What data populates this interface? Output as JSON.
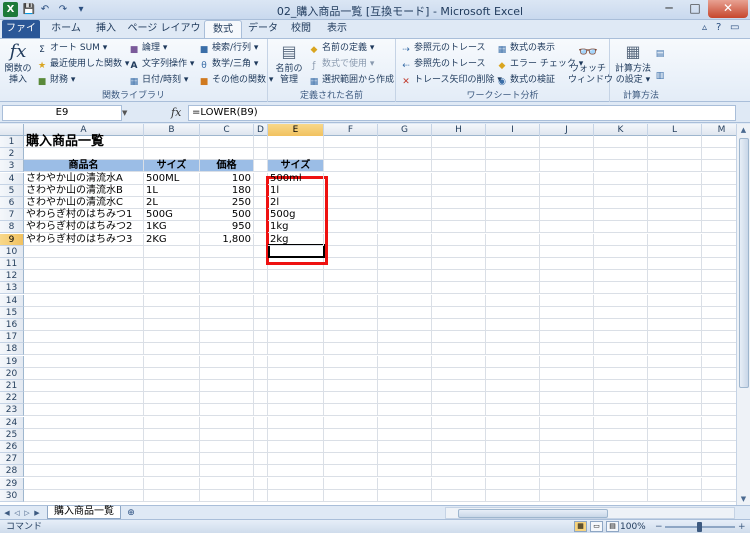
{
  "window": {
    "title": "02_購入商品一覧 [互換モード] - Microsoft Excel",
    "minimize": "─",
    "maximize": "□",
    "close": "✕",
    "app_icon": "X"
  },
  "quick_access": {
    "save_icon": "💾",
    "undo_icon": "↶",
    "redo_icon": "↷",
    "customize_icon": "▾"
  },
  "tabs": [
    {
      "label": "ファイル"
    },
    {
      "label": "ホーム"
    },
    {
      "label": "挿入"
    },
    {
      "label": "ページ レイアウト"
    },
    {
      "label": "数式"
    },
    {
      "label": "データ"
    },
    {
      "label": "校閲"
    },
    {
      "label": "表示"
    }
  ],
  "active_tab": "数式",
  "ribbon": {
    "function_library": {
      "label": "関数ライブラリ",
      "insert_function": "関数の\n挿入",
      "autosum": "オート SUM ▾",
      "recent": "最近使用した関数 ▾",
      "financial": "財務 ▾",
      "logical": "論理 ▾",
      "text": "文字列操作 ▾",
      "datetime": "日付/時刻 ▾",
      "lookup": "検索/行列 ▾",
      "math": "数学/三角 ▾",
      "more": "その他の関数 ▾"
    },
    "defined_names": {
      "label": "定義された名前",
      "name_manager": "名前の\n管理",
      "define_name": "名前の定義 ▾",
      "use_in_formula": "数式で使用 ▾",
      "create_from_selection": "選択範囲から作成"
    },
    "formula_auditing": {
      "label": "ワークシート分析",
      "trace_precedents": "参照元のトレース",
      "trace_dependents": "参照先のトレース",
      "remove_arrows": "トレース矢印の削除 ▾",
      "show_formulas": "数式の表示",
      "error_checking": "エラー チェック ▾",
      "evaluate_formula": "数式の検証",
      "watch_window": "ウォッチ\nウィンドウ"
    },
    "calculation": {
      "label": "計算方法",
      "calc_options": "計算方法\nの設定 ▾"
    }
  },
  "formula_bar": {
    "name_box": "E9",
    "fx": "fx",
    "formula": "=LOWER(B9)"
  },
  "columns": [
    "A",
    "B",
    "C",
    "D",
    "E",
    "F",
    "G",
    "H",
    "I",
    "J",
    "K",
    "L",
    "M"
  ],
  "selected_column": "E",
  "selected_row": 9,
  "row_count": 30,
  "sheet": {
    "title": "購入商品一覧",
    "headers": {
      "name": "商品名",
      "size": "サイズ",
      "price": "価格",
      "size_lower": "サイズ"
    },
    "rows": [
      {
        "name": "さわやか山の清流水A",
        "size": "500ML",
        "price": "100",
        "lower": "500ml"
      },
      {
        "name": "さわやか山の清流水B",
        "size": "1L",
        "price": "180",
        "lower": "1l"
      },
      {
        "name": "さわやか山の清流水C",
        "size": "2L",
        "price": "250",
        "lower": "2l"
      },
      {
        "name": "やわらぎ村のはちみつ1",
        "size": "500G",
        "price": "500",
        "lower": "500g"
      },
      {
        "name": "やわらぎ村のはちみつ2",
        "size": "1KG",
        "price": "950",
        "lower": "1kg"
      },
      {
        "name": "やわらぎ村のはちみつ3",
        "size": "2KG",
        "price": "1,800",
        "lower": "2kg"
      }
    ]
  },
  "sheet_tabs": [
    {
      "label": "購入商品一覧"
    }
  ],
  "status": {
    "mode": "コマンド",
    "zoom": "100%"
  },
  "colors": {
    "header_fill": "#9bbde6",
    "highlight_border": "#ee1111",
    "file_tab": "#2b5797"
  }
}
